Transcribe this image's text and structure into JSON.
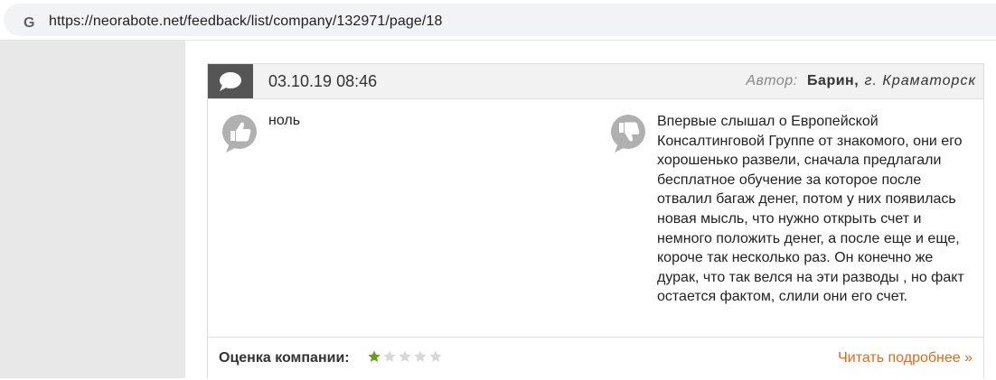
{
  "browser": {
    "url": "https://neorabote.net/feedback/list/company/132971/page/18"
  },
  "review": {
    "date": "03.10.19 08:46",
    "author_label": "Автор:",
    "author_name": "Барин,",
    "author_city": "г. Краматорск",
    "pros": "ноль",
    "cons": "Впервые слышал о Европейской Консалтинговой Группе от знакомого, они его хорошенько развели, сначала предлагали бесплатное обучение за которое после отвалил багаж денег, потом у них появилась новая мысль, что нужно открыть счет и немного положить денег, а после еще и еще, короче так несколько раз. Он конечно же дурак, что так велся на эти разводы , но факт остается фактом, слили они его счет.",
    "rating_label": "Оценка компании:",
    "rating": 1,
    "rating_max": 5,
    "read_more": "Читать подробнее »"
  },
  "colors": {
    "star_filled": "#6a9a1f",
    "star_empty": "#d8d8d8",
    "link": "#e06a1a",
    "icon_gray": "#b0b0b0"
  },
  "icons": [
    "google-icon",
    "comment-bubble-icon",
    "thumbs-up-icon",
    "thumbs-down-icon",
    "star-icon"
  ]
}
